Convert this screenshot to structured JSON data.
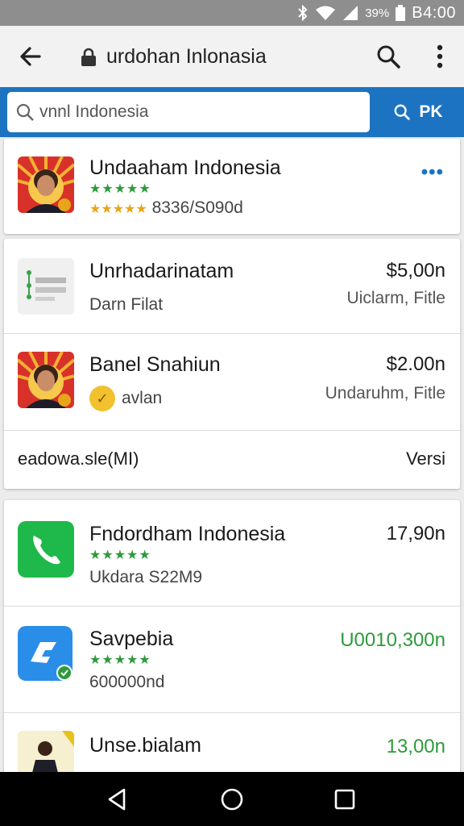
{
  "status": {
    "battery": "39%",
    "time": "B4:00"
  },
  "appbar": {
    "title": "urdohan Inlonasia"
  },
  "search": {
    "value": "vnnl Indonesia",
    "button_label": "PK"
  },
  "featured": {
    "name": "Undaaham Indonesia",
    "rating_line": "8336/S090d"
  },
  "list1": [
    {
      "name": "Unrhadarinatam",
      "sub": "Darn Filat",
      "price": "$5,00n",
      "meta": "Uiclarm, Fitle"
    },
    {
      "name": "Banel Snahiun",
      "sub": "avlan",
      "price": "$2.00n",
      "meta": "Undaruhm, Fitle"
    }
  ],
  "list1_footer": {
    "left": "eadowa.sle(MI)",
    "right": "Versi"
  },
  "list2": [
    {
      "name": "Fndordham Indonesia",
      "sub": "Ukdara S22M9",
      "price": "17,90n"
    },
    {
      "name": "Savpebia",
      "sub": "600000nd",
      "price": "U0010,300n"
    },
    {
      "name": "Unse.bialam",
      "sub": "",
      "price": "13,00n"
    }
  ],
  "colors": {
    "accent": "#1c73c2",
    "rating_green": "#2e9a3c",
    "phone_green": "#1fb84a",
    "app_blue": "#2a8ee8",
    "statusbar": "#8e8e8e"
  }
}
